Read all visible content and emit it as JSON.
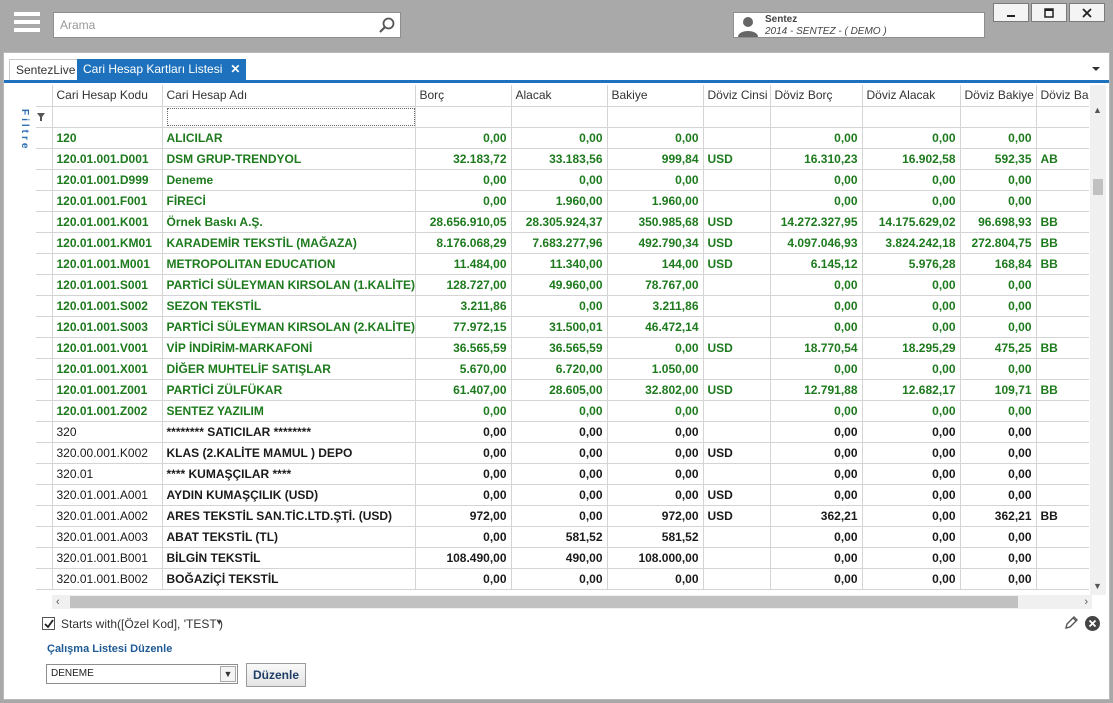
{
  "topbar": {
    "search_placeholder": "Arama",
    "user": {
      "name": "Sentez",
      "company": "2014 - SENTEZ - ( DEMO )"
    },
    "window_buttons": [
      "minimize-icon",
      "maximize-icon",
      "close-icon"
    ]
  },
  "tabs": [
    {
      "label": "SentezLive",
      "active": false
    },
    {
      "label": "Cari Hesap Kartları Listesi",
      "active": true,
      "close": "✕"
    }
  ],
  "side_filter_label": "Filtre",
  "grid": {
    "columns": [
      "Cari Hesap Kodu",
      "Cari Hesap Adı",
      "Borç",
      "Alacak",
      "Bakiye",
      "Döviz Cinsi",
      "Döviz Borç",
      "Döviz Alacak",
      "Döviz Bakiye",
      "Döviz Ba"
    ],
    "rows": [
      {
        "style": "green",
        "cells": [
          "120",
          "ALICILAR",
          "0,00",
          "0,00",
          "0,00",
          "",
          "0,00",
          "0,00",
          "0,00",
          ""
        ]
      },
      {
        "style": "green",
        "cells": [
          "120.01.001.D001",
          "DSM GRUP-TRENDYOL",
          "32.183,72",
          "33.183,56",
          "999,84",
          "USD",
          "16.310,23",
          "16.902,58",
          "592,35",
          "AB"
        ]
      },
      {
        "style": "green",
        "cells": [
          "120.01.001.D999",
          "Deneme",
          "0,00",
          "0,00",
          "0,00",
          "",
          "0,00",
          "0,00",
          "0,00",
          ""
        ]
      },
      {
        "style": "green",
        "cells": [
          "120.01.001.F001",
          "FİRECİ",
          "0,00",
          "1.960,00",
          "1.960,00",
          "",
          "0,00",
          "0,00",
          "0,00",
          ""
        ]
      },
      {
        "style": "green",
        "cells": [
          "120.01.001.K001",
          "Örnek Baskı A.Ş.",
          "28.656.910,05",
          "28.305.924,37",
          "350.985,68",
          "USD",
          "14.272.327,95",
          "14.175.629,02",
          "96.698,93",
          "BB"
        ]
      },
      {
        "style": "green",
        "cells": [
          "120.01.001.KM01",
          "KARADEMİR TEKSTİL (MAĞAZA)",
          "8.176.068,29",
          "7.683.277,96",
          "492.790,34",
          "USD",
          "4.097.046,93",
          "3.824.242,18",
          "272.804,75",
          "BB"
        ]
      },
      {
        "style": "green",
        "cells": [
          "120.01.001.M001",
          "METROPOLITAN EDUCATION",
          "11.484,00",
          "11.340,00",
          "144,00",
          "USD",
          "6.145,12",
          "5.976,28",
          "168,84",
          "BB"
        ]
      },
      {
        "style": "green",
        "cells": [
          "120.01.001.S001",
          "PARTİCİ SÜLEYMAN KIRSOLAN (1.KALİTE)",
          "128.727,00",
          "49.960,00",
          "78.767,00",
          "",
          "0,00",
          "0,00",
          "0,00",
          ""
        ]
      },
      {
        "style": "green",
        "cells": [
          "120.01.001.S002",
          "SEZON TEKSTİL",
          "3.211,86",
          "0,00",
          "3.211,86",
          "",
          "0,00",
          "0,00",
          "0,00",
          ""
        ]
      },
      {
        "style": "green",
        "cells": [
          "120.01.001.S003",
          "PARTİCİ SÜLEYMAN KIRSOLAN (2.KALİTE)",
          "77.972,15",
          "31.500,01",
          "46.472,14",
          "",
          "0,00",
          "0,00",
          "0,00",
          ""
        ]
      },
      {
        "style": "green",
        "cells": [
          "120.01.001.V001",
          "VİP İNDİRİM-MARKAFONİ",
          "36.565,59",
          "36.565,59",
          "0,00",
          "USD",
          "18.770,54",
          "18.295,29",
          "475,25",
          "BB"
        ]
      },
      {
        "style": "green",
        "cells": [
          "120.01.001.X001",
          "DİĞER MUHTELİF SATIŞLAR",
          "5.670,00",
          "6.720,00",
          "1.050,00",
          "",
          "0,00",
          "0,00",
          "0,00",
          ""
        ]
      },
      {
        "style": "green",
        "cells": [
          "120.01.001.Z001",
          "PARTİCİ ZÜLFÜKAR",
          "61.407,00",
          "28.605,00",
          "32.802,00",
          "USD",
          "12.791,88",
          "12.682,17",
          "109,71",
          "BB"
        ]
      },
      {
        "style": "green",
        "cells": [
          "120.01.001.Z002",
          "SENTEZ YAZILIM",
          "0,00",
          "0,00",
          "0,00",
          "",
          "0,00",
          "0,00",
          "0,00",
          ""
        ]
      },
      {
        "style": "black",
        "cells": [
          "320",
          "******** SATICILAR ********",
          "0,00",
          "0,00",
          "0,00",
          "",
          "0,00",
          "0,00",
          "0,00",
          ""
        ]
      },
      {
        "style": "black",
        "cells": [
          "320.00.001.K002",
          "KLAS (2.KALİTE MAMUL ) DEPO",
          "0,00",
          "0,00",
          "0,00",
          "USD",
          "0,00",
          "0,00",
          "0,00",
          ""
        ]
      },
      {
        "style": "black",
        "cells": [
          "320.01",
          "**** KUMAŞÇILAR ****",
          "0,00",
          "0,00",
          "0,00",
          "",
          "0,00",
          "0,00",
          "0,00",
          ""
        ]
      },
      {
        "style": "black",
        "cells": [
          "320.01.001.A001",
          "AYDIN KUMAŞÇILIK (USD)",
          "0,00",
          "0,00",
          "0,00",
          "USD",
          "0,00",
          "0,00",
          "0,00",
          ""
        ]
      },
      {
        "style": "black",
        "cells": [
          "320.01.001.A002",
          "ARES TEKSTİL SAN.TİC.LTD.ŞTİ. (USD)",
          "972,00",
          "0,00",
          "972,00",
          "USD",
          "362,21",
          "0,00",
          "362,21",
          "BB"
        ]
      },
      {
        "style": "black",
        "cells": [
          "320.01.001.A003",
          "ABAT TEKSTİL (TL)",
          "0,00",
          "581,52",
          "581,52",
          "",
          "0,00",
          "0,00",
          "0,00",
          ""
        ]
      },
      {
        "style": "black",
        "cells": [
          "320.01.001.B001",
          "BİLGİN TEKSTİL",
          "108.490,00",
          "490,00",
          "108.000,00",
          "",
          "0,00",
          "0,00",
          "0,00",
          ""
        ]
      },
      {
        "style": "black",
        "cells": [
          "320.01.001.B002",
          "BOĞAZİÇİ TEKSTİL",
          "0,00",
          "0,00",
          "0,00",
          "",
          "0,00",
          "0,00",
          "0,00",
          ""
        ]
      }
    ]
  },
  "filter": {
    "text": "Starts with([Özel Kod], 'TEST')",
    "checked": true
  },
  "worklist": {
    "label": "Çalışma Listesi Düzenle",
    "selected": "DENEME",
    "button": "Düzenle"
  }
}
